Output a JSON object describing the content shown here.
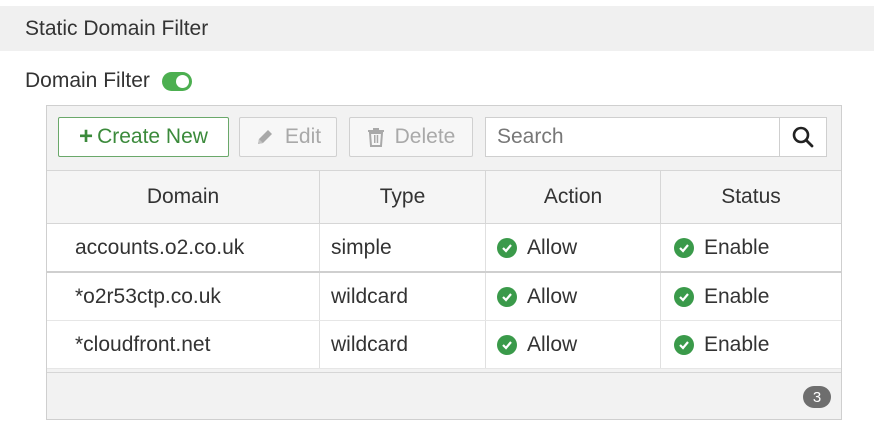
{
  "section": {
    "title": "Static Domain Filter"
  },
  "filter": {
    "label": "Domain Filter",
    "enabled": true
  },
  "toolbar": {
    "create_label": "Create New",
    "edit_label": "Edit",
    "delete_label": "Delete",
    "search_placeholder": "Search"
  },
  "table": {
    "columns": [
      "Domain",
      "Type",
      "Action",
      "Status"
    ],
    "rows": [
      {
        "domain": "accounts.o2.co.uk",
        "type": "simple",
        "action": "Allow",
        "status": "Enable"
      },
      {
        "domain": "*o2r53ctp.co.uk",
        "type": "wildcard",
        "action": "Allow",
        "status": "Enable"
      },
      {
        "domain": "*cloudfront.net",
        "type": "wildcard",
        "action": "Allow",
        "status": "Enable"
      }
    ]
  },
  "footer": {
    "count": "3"
  },
  "colors": {
    "accent": "#3b8a3b",
    "toggle_on": "#4caf50",
    "status_ok": "#3a9a4a"
  }
}
